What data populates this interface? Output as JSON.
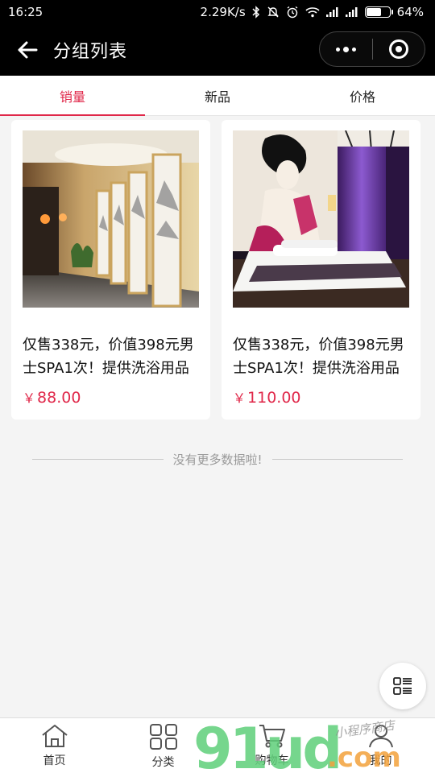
{
  "status_bar": {
    "time": "16:25",
    "network_speed": "2.29K/s",
    "battery_percent": "64%",
    "battery_level": 0.64,
    "icons": [
      "bluetooth-icon",
      "mute-icon",
      "alarm-icon",
      "wifi-icon",
      "signal-icon",
      "signal-icon",
      "battery-icon"
    ]
  },
  "nav": {
    "title": "分组列表",
    "back_icon": "back-arrow-icon",
    "menu_icon": "more-dots-icon",
    "close_icon": "target-circle-icon"
  },
  "tabs": [
    {
      "label": "销量",
      "active": true
    },
    {
      "label": "新品",
      "active": false
    },
    {
      "label": "价格",
      "active": false
    }
  ],
  "accent_color": "#e0284a",
  "products": [
    {
      "title": "仅售338元，价值398元男士SPA1次！提供洗浴用品",
      "price": "88.00",
      "currency": "￥",
      "image": "hallway-ink-paintings"
    },
    {
      "title": "仅售338元，价值398元男士SPA1次！提供洗浴用品",
      "price": "110.00",
      "currency": "￥",
      "image": "bedroom-geisha-mural"
    }
  ],
  "no_more_text": "没有更多数据啦!",
  "float_button_icon": "list-icon",
  "tabbar": [
    {
      "label": "首页",
      "icon": "home-icon"
    },
    {
      "label": "分类",
      "icon": "grid-icon"
    },
    {
      "label": "购物车",
      "icon": "cart-icon"
    },
    {
      "label": "我的",
      "icon": "user-icon"
    }
  ],
  "watermark": {
    "brand": "91ud",
    "domain": ".com",
    "slogan": "小程序商店"
  }
}
